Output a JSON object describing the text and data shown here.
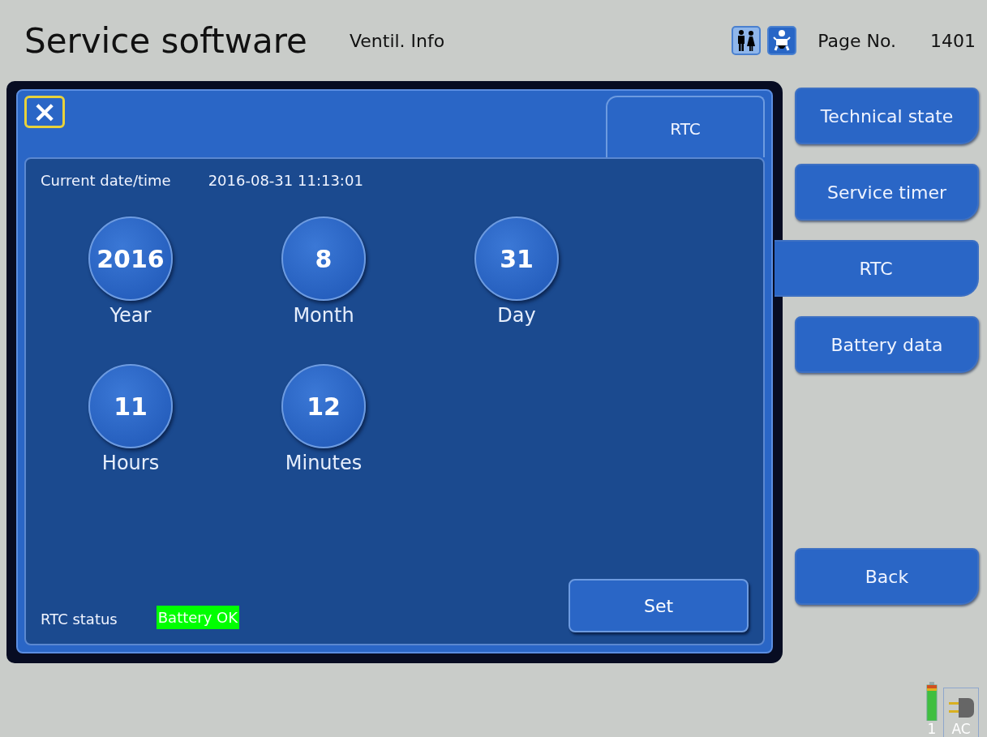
{
  "header": {
    "title": "Service software",
    "subtitle": "Ventil. Info",
    "patient_modes": [
      {
        "kind": "adult",
        "selected": true
      },
      {
        "kind": "child",
        "selected": false
      }
    ],
    "page_label": "Page No.",
    "page_number": "1401"
  },
  "panel": {
    "close_symbol": "×",
    "tab": "RTC",
    "current_label": "Current date/time",
    "current_value": "2016-08-31 11:13:01",
    "dials": [
      {
        "value": "2016",
        "label": "Year"
      },
      {
        "value": "8",
        "label": "Month"
      },
      {
        "value": "31",
        "label": "Day"
      },
      {
        "value": "11",
        "label": "Hours"
      },
      {
        "value": "12",
        "label": "Minutes"
      }
    ],
    "status_label": "RTC status",
    "status_value": "Battery OK",
    "status_ok": true,
    "set_button": "Set"
  },
  "sidebar": {
    "items": [
      {
        "label": "Technical state",
        "selected": false
      },
      {
        "label": "Service timer",
        "selected": false
      },
      {
        "label": "RTC",
        "selected": true
      },
      {
        "label": "Battery data",
        "selected": false
      }
    ],
    "back": "Back"
  },
  "status_bar": {
    "battery_label": "1",
    "power_label": "AC"
  }
}
